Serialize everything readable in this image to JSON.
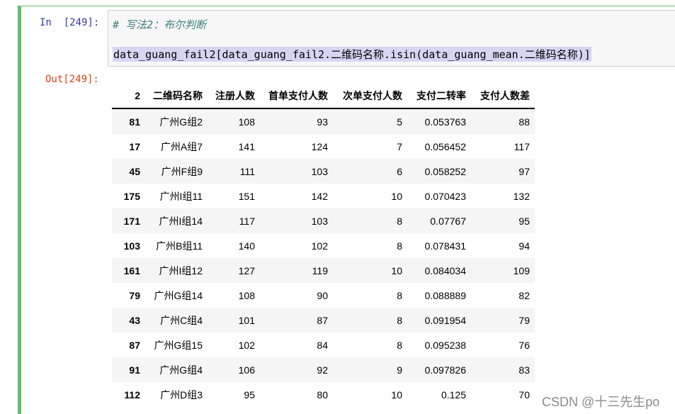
{
  "input_cell": {
    "prompt": "In  [249]:",
    "comment": "# 写法2：布尔判断",
    "code": "data_guang_fail2[data_guang_fail2.二维码名称.isin(data_guang_mean.二维码名称)]"
  },
  "output_cell": {
    "prompt": "Out[249]:",
    "table": {
      "index_header": "2",
      "columns": [
        "二维码名称",
        "注册人数",
        "首单支付人数",
        "次单支付人数",
        "支付二转率",
        "支付人数差"
      ],
      "rows": [
        {
          "index": "81",
          "cells": [
            "广州G组2",
            "108",
            "93",
            "5",
            "0.053763",
            "88"
          ]
        },
        {
          "index": "17",
          "cells": [
            "广州A组7",
            "141",
            "124",
            "7",
            "0.056452",
            "117"
          ]
        },
        {
          "index": "45",
          "cells": [
            "广州F组9",
            "111",
            "103",
            "6",
            "0.058252",
            "97"
          ]
        },
        {
          "index": "175",
          "cells": [
            "广州I组11",
            "151",
            "142",
            "10",
            "0.070423",
            "132"
          ]
        },
        {
          "index": "171",
          "cells": [
            "广州I组14",
            "117",
            "103",
            "8",
            "0.07767",
            "95"
          ]
        },
        {
          "index": "103",
          "cells": [
            "广州B组11",
            "140",
            "102",
            "8",
            "0.078431",
            "94"
          ]
        },
        {
          "index": "161",
          "cells": [
            "广州I组12",
            "127",
            "119",
            "10",
            "0.084034",
            "109"
          ]
        },
        {
          "index": "79",
          "cells": [
            "广州G组14",
            "108",
            "90",
            "8",
            "0.088889",
            "82"
          ]
        },
        {
          "index": "43",
          "cells": [
            "广州C组4",
            "101",
            "87",
            "8",
            "0.091954",
            "79"
          ]
        },
        {
          "index": "87",
          "cells": [
            "广州G组15",
            "102",
            "84",
            "8",
            "0.095238",
            "76"
          ]
        },
        {
          "index": "91",
          "cells": [
            "广州G组4",
            "106",
            "92",
            "9",
            "0.097826",
            "83"
          ]
        },
        {
          "index": "112",
          "cells": [
            "广州D组3",
            "95",
            "80",
            "10",
            "0.125",
            "70"
          ]
        }
      ]
    }
  },
  "watermark": "CSDN @十三先生po",
  "colors": {
    "cell_border": "#66bb6a",
    "in_prompt": "#303f9f",
    "out_prompt": "#d84315",
    "comment": "#408080"
  }
}
